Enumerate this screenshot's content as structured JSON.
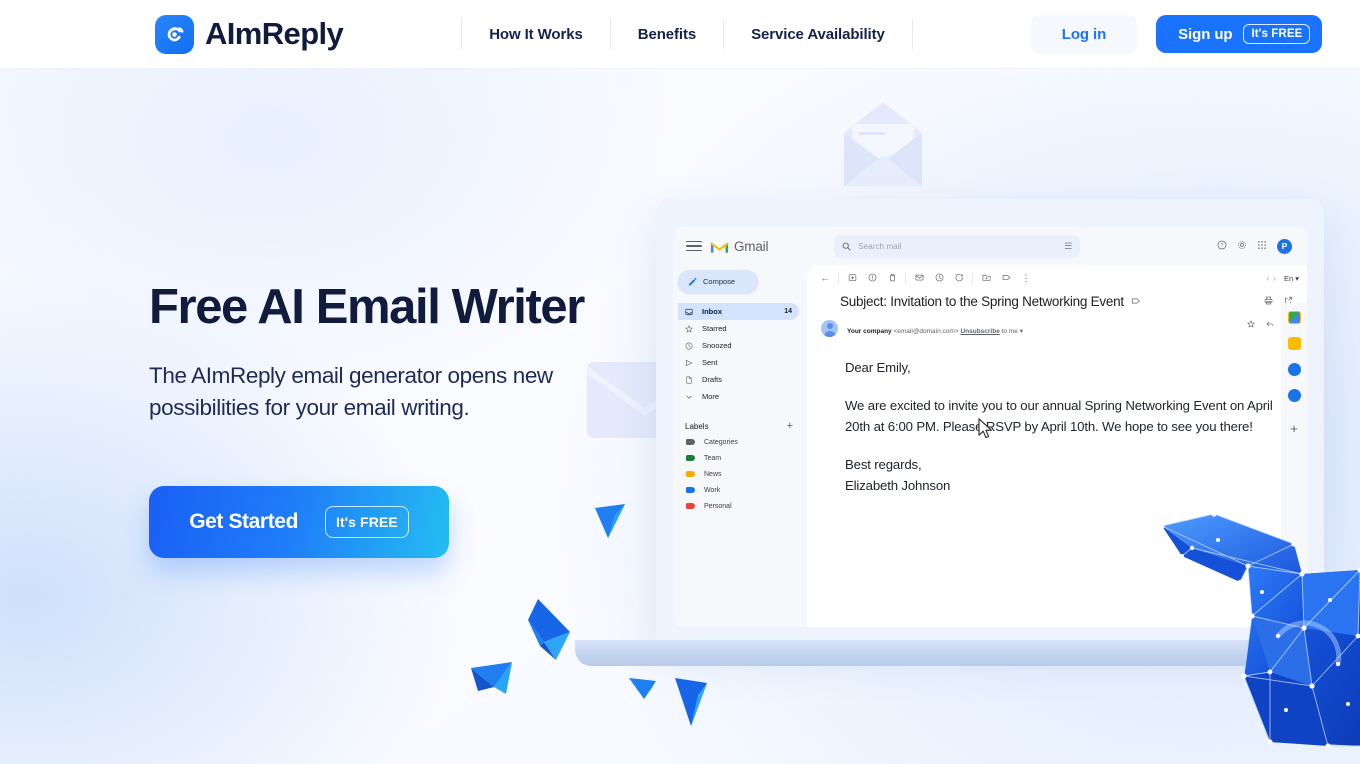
{
  "header": {
    "brand_name": "AImReply",
    "brand_icon": "swirl-logo-icon",
    "nav": [
      {
        "label": "How It Works"
      },
      {
        "label": "Benefits"
      },
      {
        "label": "Service Availability"
      }
    ],
    "login_label": "Log in",
    "signup_label": "Sign up",
    "signup_badge": "It's FREE"
  },
  "hero": {
    "title": "Free AI Email Writer",
    "subtitle": "The AImReply email generator opens new possibilities for your email writing.",
    "cta_label": "Get Started",
    "cta_badge": "It's FREE"
  },
  "gmail": {
    "logo_text": "Gmail",
    "search_placeholder": "Search mail",
    "avatar_initial": "P",
    "compose_label": "Compose",
    "nav_items": [
      {
        "label": "Inbox",
        "count": "14",
        "icon": "inbox-icon",
        "active": true
      },
      {
        "label": "Starred",
        "count": "",
        "icon": "star-icon",
        "active": false
      },
      {
        "label": "Snoozed",
        "count": "",
        "icon": "clock-icon",
        "active": false
      },
      {
        "label": "Sent",
        "count": "",
        "icon": "send-icon",
        "active": false
      },
      {
        "label": "Drafts",
        "count": "",
        "icon": "document-icon",
        "active": false
      },
      {
        "label": "More",
        "count": "",
        "icon": "chevron-down-icon",
        "active": false
      }
    ],
    "labels_title": "Labels",
    "labels": [
      {
        "label": "Categories",
        "color": "#5f6368"
      },
      {
        "label": "Team",
        "color": "#188038"
      },
      {
        "label": "News",
        "color": "#f9ab00"
      },
      {
        "label": "Work",
        "color": "#1a73e8"
      },
      {
        "label": "Personal",
        "color": "#ea4335"
      }
    ],
    "language": "En",
    "email": {
      "subject": "Subject: Invitation to the Spring Networking Event",
      "sender_name": "Your company",
      "sender_address": "<email@domain.com>",
      "unsubscribe_label": "Unsubscribe",
      "recipient": "to me",
      "body_paragraphs": [
        "Dear Emily,",
        "We are excited to invite you to our annual Spring Networking Event on April 20th at 6:00 PM. Please RSVP by April 10th. We hope to see you there!",
        "Best regards,\nElizabeth Johnson"
      ]
    }
  },
  "colors": {
    "brand_blue": "#1a73ff",
    "headline_navy": "#101b3d",
    "cta_gradient_start": "#1a5ff5",
    "cta_gradient_end": "#25bdf2"
  }
}
